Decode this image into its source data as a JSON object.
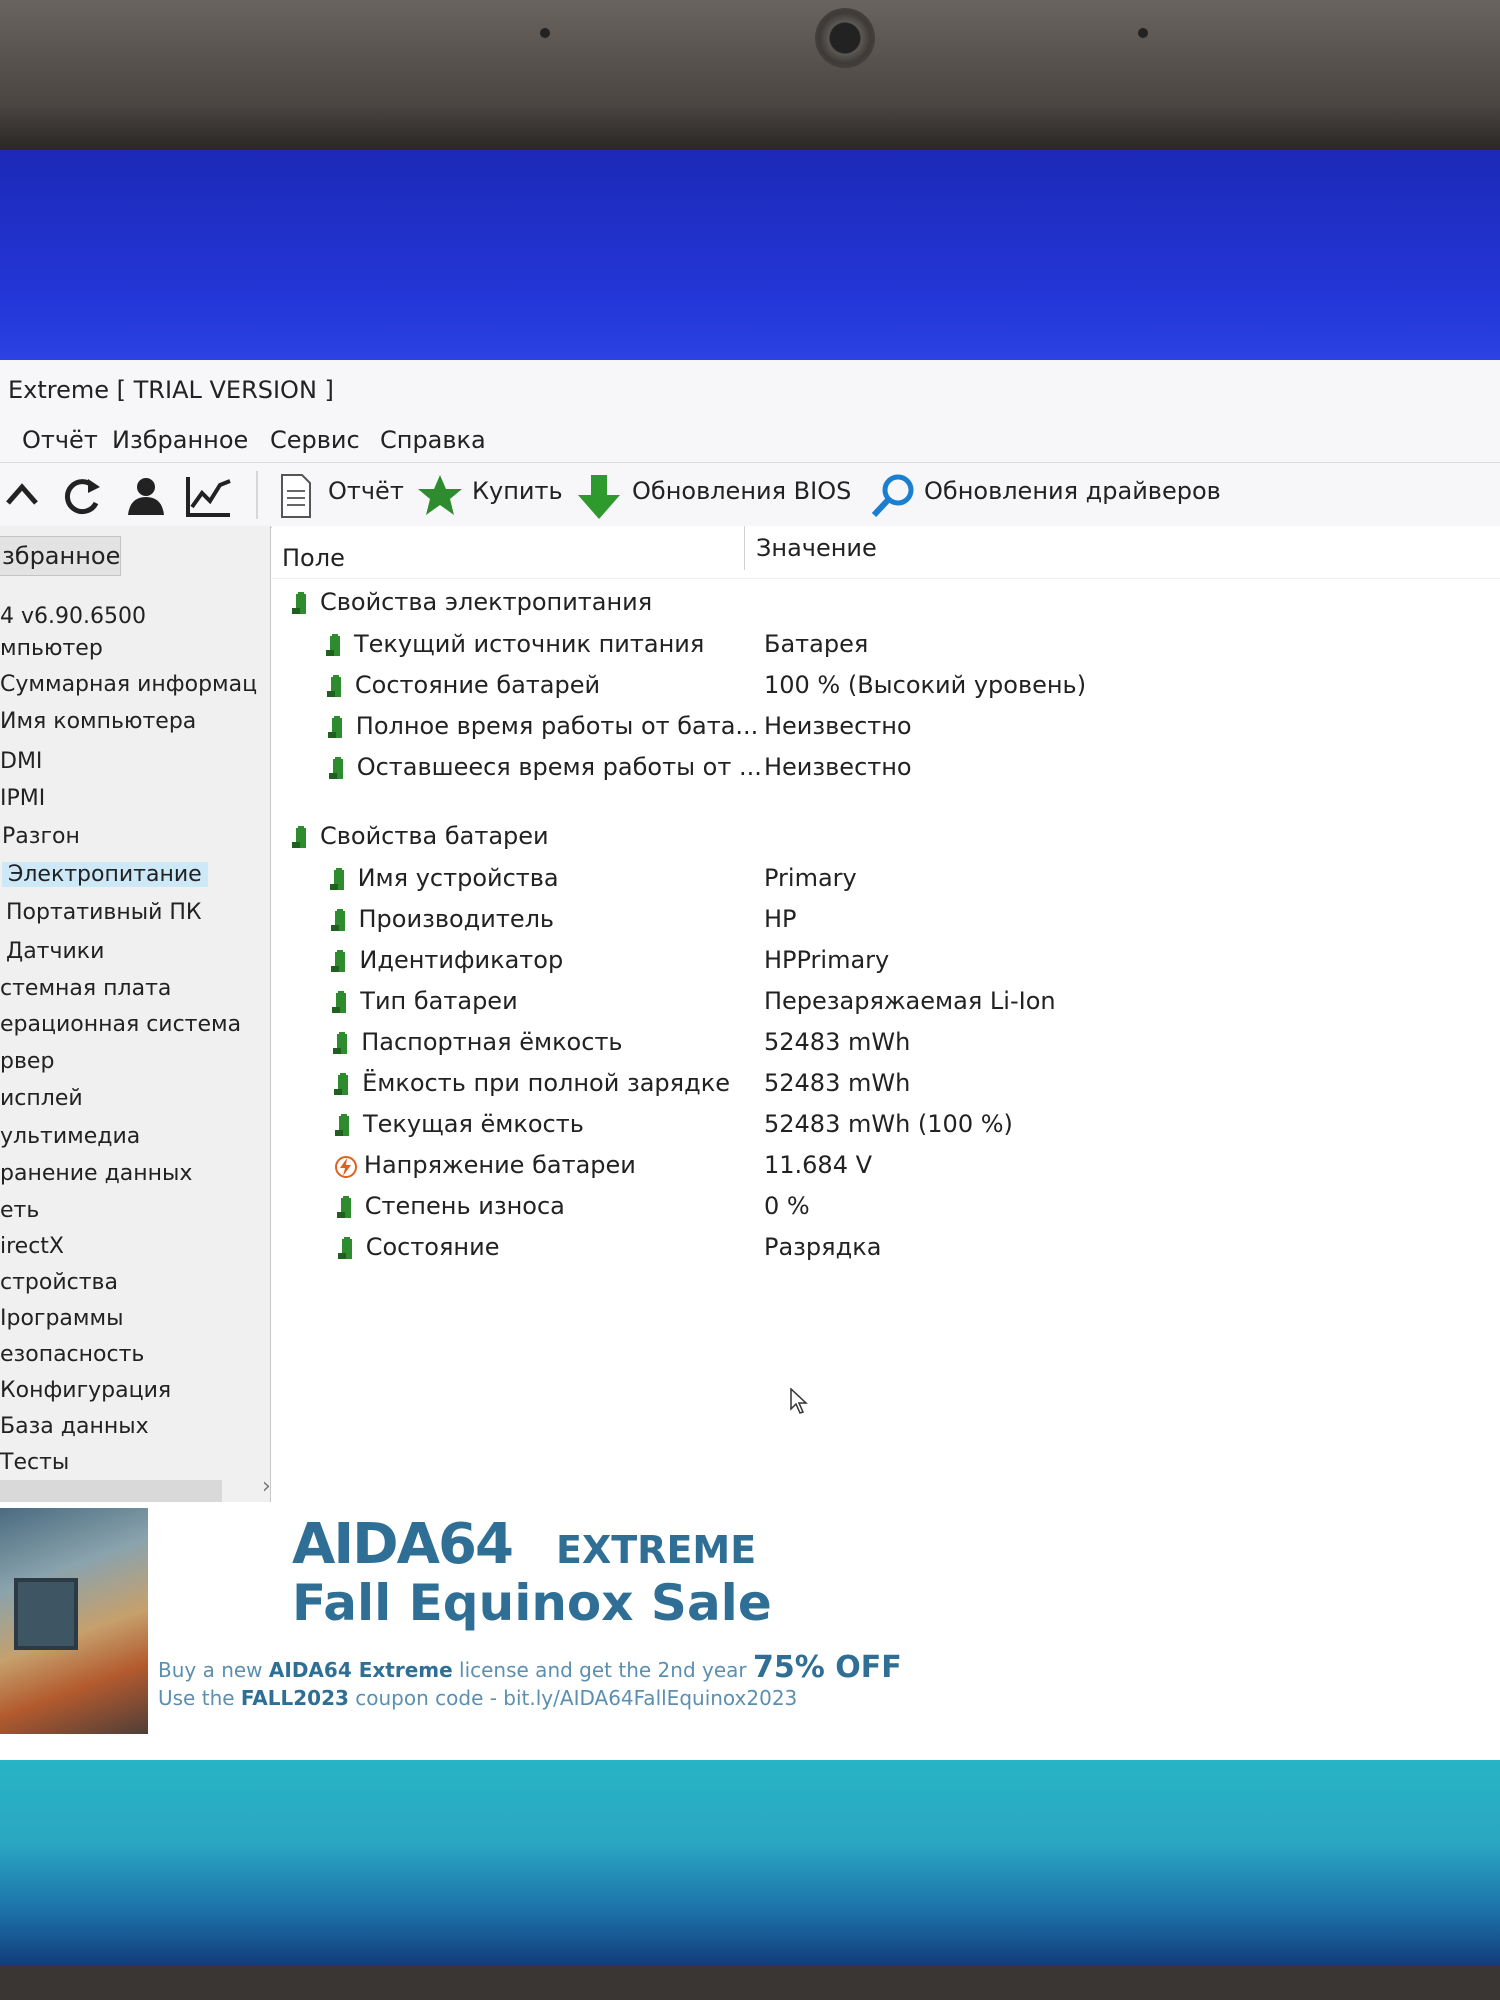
{
  "window": {
    "title": "Extreme  [ TRIAL VERSION ]"
  },
  "menu": [
    "Отчёт",
    "Избранное",
    "Сервис",
    "Справка"
  ],
  "toolbar": {
    "icons": [
      "chevron-up-icon",
      "refresh-icon",
      "user-icon",
      "chart-icon"
    ],
    "report_label": "Отчёт",
    "buy_label": "Купить",
    "bios_label": "Обновления BIOS",
    "drivers_label": "Обновления драйверов"
  },
  "sidebar": {
    "tab_label": "збранное",
    "items": [
      "4 v6.90.6500",
      "мпьютер",
      "Суммарная информац",
      "Имя компьютера",
      "DMI",
      "IPMI",
      "Разгон",
      "Электропитание",
      "Портативный ПК",
      "Датчики",
      "стемная плата",
      "ерационная система",
      "рвер",
      "исплей",
      "ультимедиа",
      "ранение данных",
      "еть",
      "irectX",
      "стройства",
      "Ірограммы",
      "езопасность",
      "Конфигурация",
      "База данных",
      "Тесты"
    ],
    "selected": "Электропитание"
  },
  "columns": {
    "field": "Поле",
    "value": "Значение"
  },
  "sections": [
    {
      "title": "Свойства электропитания",
      "rows": [
        {
          "field": "Текущий источник питания",
          "value": "Батарея"
        },
        {
          "field": "Состояние батарей",
          "value": "100 % (Высокий уровень)"
        },
        {
          "field": "Полное время работы от бата...",
          "value": "Неизвестно"
        },
        {
          "field": "Оставшееся время работы от ...",
          "value": "Неизвестно"
        }
      ]
    },
    {
      "title": "Свойства батареи",
      "rows": [
        {
          "field": "Имя устройства",
          "value": "Primary"
        },
        {
          "field": "Производитель",
          "value": "HP"
        },
        {
          "field": "Идентификатор",
          "value": "HPPrimary"
        },
        {
          "field": "Тип батареи",
          "value": "Перезаряжаемая Li-Ion"
        },
        {
          "field": "Паспортная ёмкость",
          "value": "52483 mWh"
        },
        {
          "field": "Ёмкость при полной зарядке",
          "value": "52483 mWh"
        },
        {
          "field": "Текущая ёмкость",
          "value": "52483 mWh  (100 %)"
        },
        {
          "field": "Напряжение батареи",
          "value": "11.684 V"
        },
        {
          "field": "Степень износа",
          "value": "0 %"
        },
        {
          "field": "Состояние",
          "value": "Разрядка"
        }
      ]
    }
  ],
  "banner": {
    "logo": "AIDA64",
    "logo_sub": "EXTREME",
    "headline": "Fall Equinox Sale",
    "line1_a": "Buy a new ",
    "line1_b": "AIDA64 Extreme",
    "line1_c": " license and get the 2nd year ",
    "line1_d": "75% OFF",
    "line2_a": "Use the ",
    "line2_b": "FALL2023",
    "line2_c": " coupon code - bit.ly/AIDA64FallEquinox2023"
  },
  "colors": {
    "desktop_blue": "#1f2ec8",
    "selection": "#cde8f6",
    "node_green": "#2e8b2e",
    "banner_blue": "#2f6f95"
  }
}
